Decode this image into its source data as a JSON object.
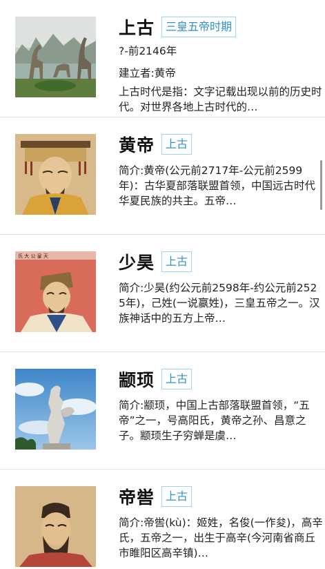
{
  "items": [
    {
      "title": "上古",
      "tag": "三皇五帝时期",
      "period": "?-前2146年",
      "founder": "建立者:黄帝",
      "desc": "上古时代是指：文字记载出现以前的历史时代。对世界各地上古时代的…",
      "image": "dinosaur-park-photo"
    },
    {
      "title": "黄帝",
      "tag": "上古",
      "desc": "简介:黄帝(公元前2717年-公元前2599年)：古华夏部落联盟首领，中国远古时代华夏民族的共主。五帝…",
      "image": "emperor-portrait"
    },
    {
      "title": "少昊",
      "tag": "上古",
      "desc": "简介:少昊(约公元前2598年-约公元前2525年)，己姓(一说嬴姓)，三皇五帝之一。汉族神话中的五方上帝…",
      "image": "ancient-ruler-portrait",
      "image_caption": "氏  大  公  皇  天"
    },
    {
      "title": "颛顼",
      "tag": "上古",
      "desc": "简介:颛顼，中国上古部落联盟首领，“五帝”之一，号高阳氏，黄帝之孙、昌意之子。颛顼生子穷蝉是虞…",
      "image": "statue-photo"
    },
    {
      "title": "帝喾",
      "tag": "上古",
      "desc": "简介:帝喾(kù)：姬姓，名俊(一作夋)，高辛氏，五帝之一，出生于高辛(今河南省商丘市睢阳区高辛镇)…",
      "image": "bearded-ruler-portrait"
    }
  ]
}
